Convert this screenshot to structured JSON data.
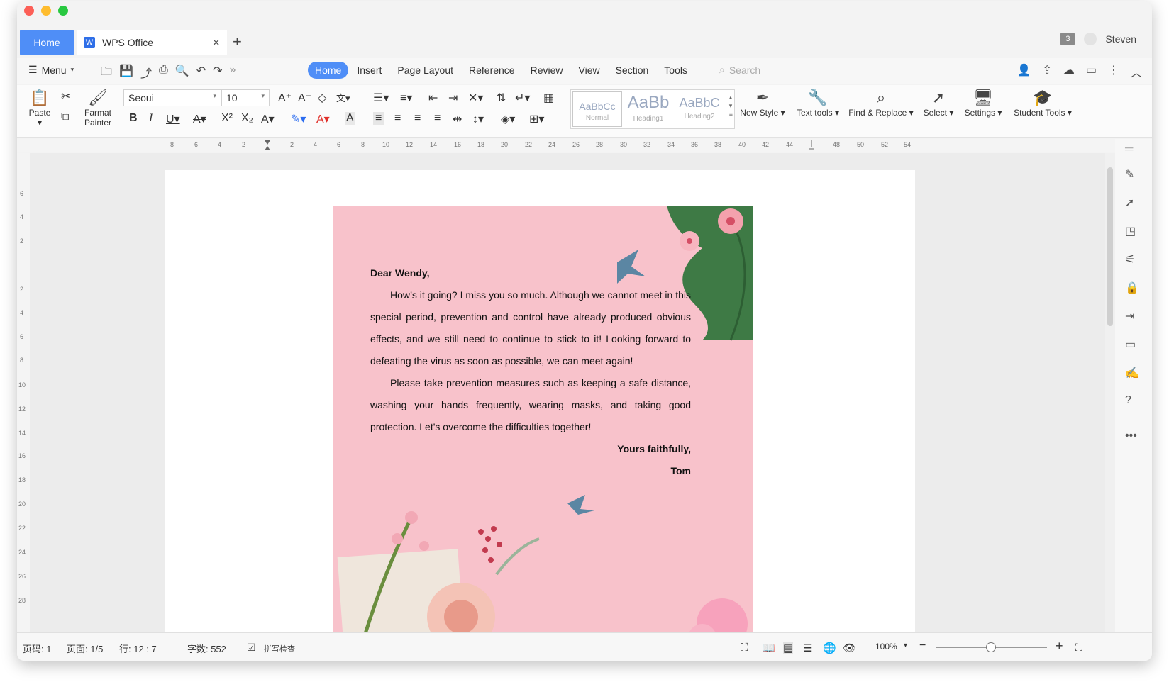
{
  "tabs": {
    "home": "Home",
    "doc": "WPS Office"
  },
  "user": {
    "name": "Steven",
    "window_count": "3"
  },
  "menu": {
    "label": "Menu"
  },
  "ribbon_tabs": [
    "Home",
    "Insert",
    "Page Layout",
    "Reference",
    "Review",
    "View",
    "Section",
    "Tools"
  ],
  "search": {
    "placeholder": "Search"
  },
  "ribbon": {
    "paste": "Paste",
    "format_painter_1": "Farmat",
    "format_painter_2": "Painter",
    "font_name": "Seoui",
    "font_size": "10",
    "styles": [
      {
        "sample": "AaBbCc",
        "label": "Normal"
      },
      {
        "sample": "AaBb",
        "label": "Heading1"
      },
      {
        "sample": "AaBbC",
        "label": "Heading2"
      }
    ],
    "new_style": "New Style",
    "text_tools": "Text tools",
    "find_replace": "Find & Replace",
    "select": "Select",
    "settings": "Settings",
    "student_tools": "Student Tools"
  },
  "letter": {
    "greeting": "Dear Wendy,",
    "para1": "How’s it going? I miss you so much. Although we cannot meet in this special period, prevention and control have already produced obvious effects, and we still need to continue to stick to it! Looking forward to defeating the virus as soon as possible, we can meet again!",
    "para2": "Please take prevention measures such as keeping a safe distance, washing your hands frequently, wearing masks, and taking good protection. Let's overcome the difficulties together!",
    "closing": "Yours faithfully,",
    "signature": "Tom"
  },
  "status": {
    "page_code": "页码: 1",
    "pages": "页面: 1/5",
    "row": "行: 12 : 7",
    "words": "字数: 552",
    "spell": "拼写检查",
    "zoom": "100%"
  },
  "colors": {
    "accent": "#4f8ef7",
    "letter_bg": "#f8c2cb"
  }
}
